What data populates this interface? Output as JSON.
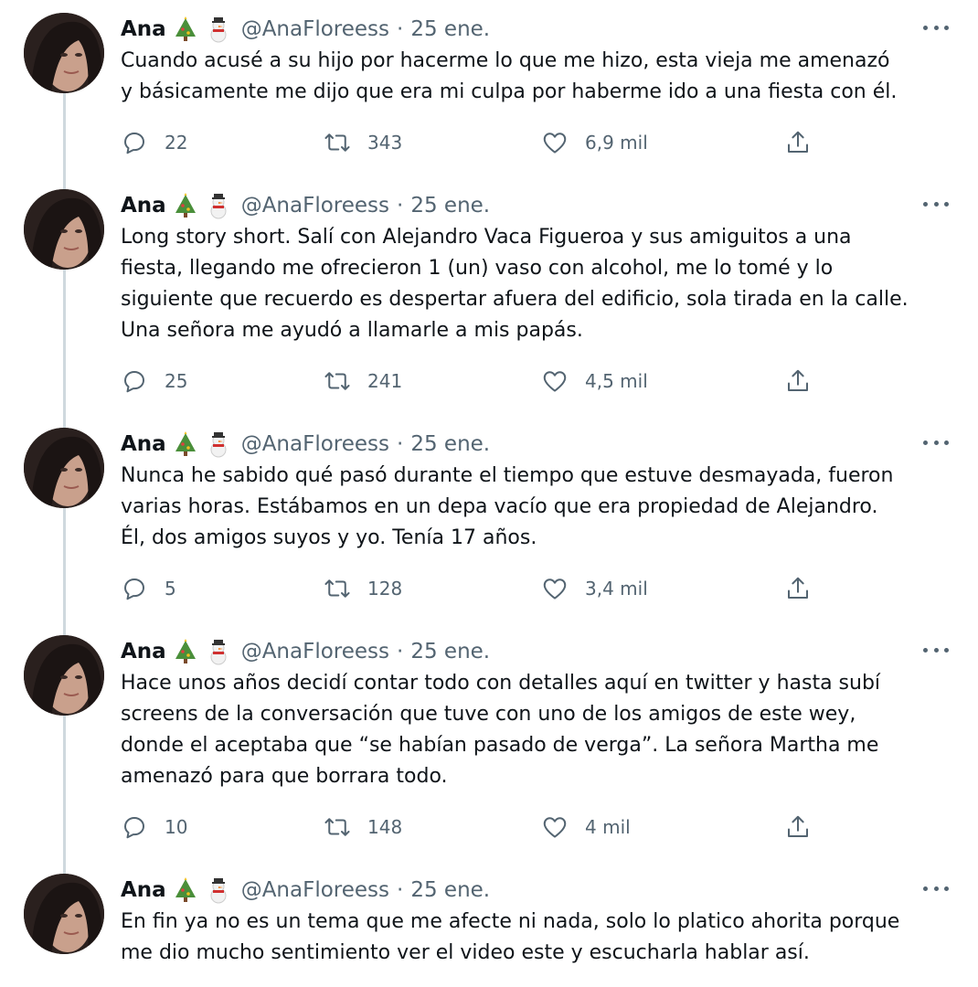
{
  "author": {
    "name": "Ana",
    "handle": "@AnaFloreess",
    "separator": "·",
    "emoji": [
      "christmas-tree-icon",
      "snowman-icon"
    ]
  },
  "colors": {
    "text": "#0f1419",
    "secondary": "#536471",
    "thread_line": "#cfd9de",
    "background": "#ffffff"
  },
  "tweets": [
    {
      "date": "25 ene.",
      "lines": [
        "Cuando acusé a su hijo por hacerme lo que me hizo, esta vieja me amenazó",
        "y básicamente me dijo que era mi culpa por haberme ido a una fiesta con él."
      ],
      "replies": "22",
      "retweets": "343",
      "likes": "6,9 mil"
    },
    {
      "date": "25 ene.",
      "lines": [
        "Long story short. Salí con Alejandro Vaca Figueroa y sus amiguitos a una",
        "fiesta, llegando me ofrecieron 1 (un) vaso con alcohol, me lo tomé y lo",
        "siguiente que recuerdo es despertar afuera del edificio, sola tirada en la calle.",
        "Una señora me ayudó a llamarle a mis papás."
      ],
      "replies": "25",
      "retweets": "241",
      "likes": "4,5 mil"
    },
    {
      "date": "25 ene.",
      "lines": [
        "Nunca he sabido qué pasó durante el tiempo que estuve desmayada, fueron",
        "varias horas. Estábamos en un depa vacío que era propiedad de Alejandro.",
        "Él, dos amigos suyos y yo. Tenía 17 años."
      ],
      "replies": "5",
      "retweets": "128",
      "likes": "3,4 mil"
    },
    {
      "date": "25 ene.",
      "lines": [
        "Hace unos años decidí contar todo con detalles aquí en twitter y hasta subí",
        "screens de la conversación que tuve con uno de los amigos de este wey,",
        "donde el aceptaba que “se habían pasado de verga”. La señora Martha me",
        "amenazó para que borrara todo."
      ],
      "replies": "10",
      "retweets": "148",
      "likes": "4 mil"
    },
    {
      "date": "25 ene.",
      "lines": [
        "En fin ya no es un tema que me afecte ni nada, solo lo platico ahorita porque",
        "me dio mucho sentimiento ver el video este y escucharla hablar así."
      ]
    }
  ]
}
